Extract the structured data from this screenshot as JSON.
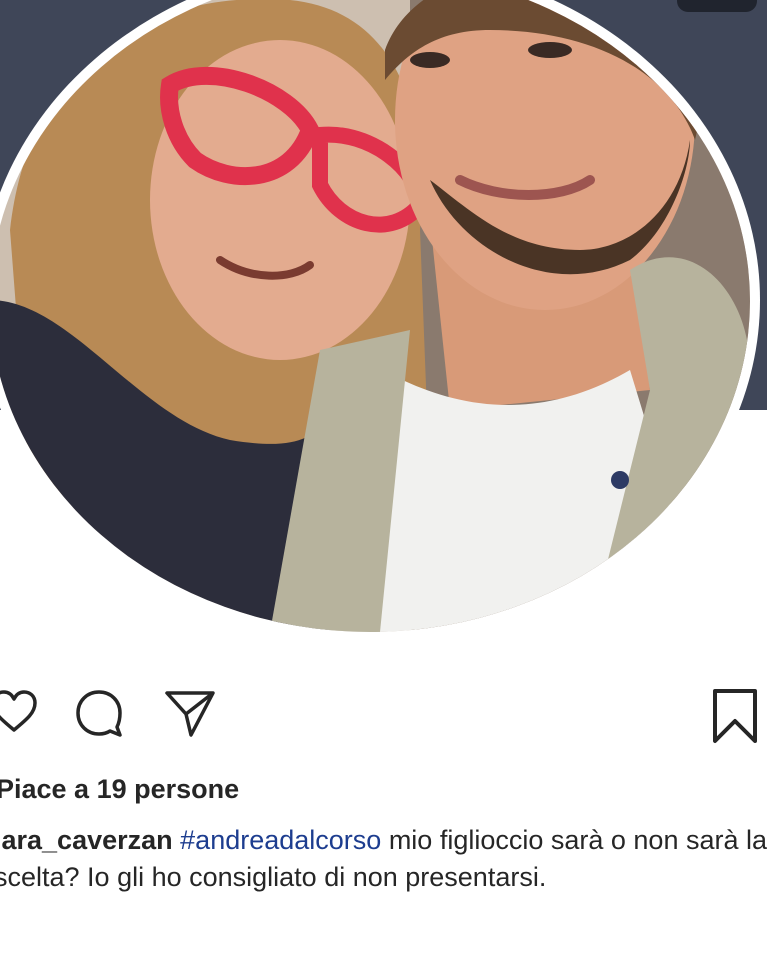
{
  "post": {
    "likes_text": "Piace a 19 persone",
    "caption": {
      "username": "lara_caverzan",
      "hashtag": "#andreadalcorso",
      "text": " mio figlioccio sarà o non sarà la scelta? Io gli ho consigliato di non presentarsi."
    }
  },
  "icons": {
    "like": "heart-icon",
    "comment": "comment-bubble-icon",
    "share": "paper-plane-icon",
    "save": "bookmark-icon"
  },
  "colors": {
    "hashtag": "#1d3d8f",
    "text": "#262626",
    "header_background": "#3f4658"
  }
}
